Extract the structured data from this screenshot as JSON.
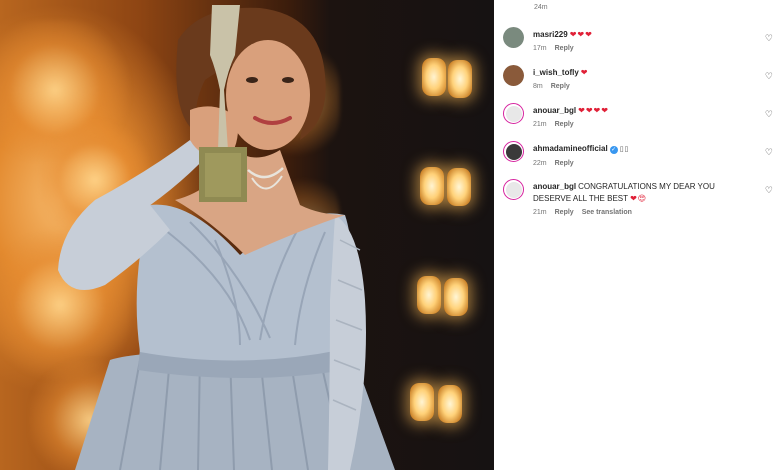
{
  "top_time": "24m",
  "comments": [
    {
      "username": "masri229",
      "text": "",
      "emoji": "❤❤❤",
      "time": "17m",
      "reply": "Reply",
      "avatar_color": "#7a8a7e",
      "ring": false
    },
    {
      "username": "i_wish_tofly",
      "text": "",
      "emoji": "❤",
      "time": "8m",
      "reply": "Reply",
      "avatar_color": "#8a5a3a",
      "ring": false
    },
    {
      "username": "anouar_bgl",
      "text": "",
      "emoji": "❤❤❤❤",
      "time": "21m",
      "reply": "Reply",
      "avatar_color": "#e8e8e8",
      "ring": true
    },
    {
      "username": "ahmadamineofficial",
      "text": "",
      "emoji": "▯▯",
      "time": "22m",
      "reply": "Reply",
      "avatar_color": "#3a3a3a",
      "ring": true
    },
    {
      "username": "anouar_bgl",
      "text": "CONGRATULATIONS MY DEAR YOU DESERVE ALL THE BEST",
      "emoji": "❤😍",
      "time": "21m",
      "reply": "Reply",
      "translate": "See translation",
      "avatar_color": "#e8e8e8",
      "ring": true
    }
  ]
}
